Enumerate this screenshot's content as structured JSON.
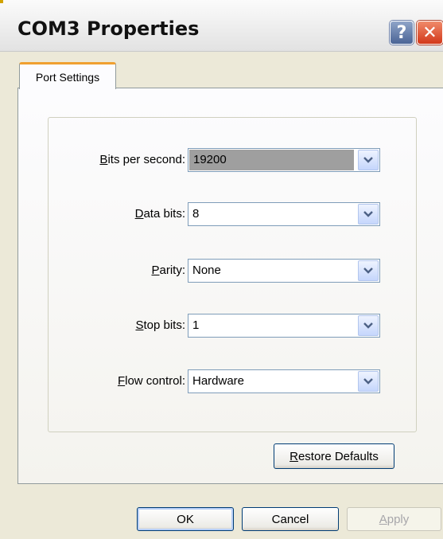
{
  "window": {
    "title": "COM3 Properties",
    "help_label": "?",
    "close_label": "✕"
  },
  "tabs": [
    {
      "label": "Port Settings",
      "active": true
    }
  ],
  "fields": {
    "bits_per_second": {
      "label_key": "B",
      "label_rest": "its per second:",
      "value": "19200",
      "selected": true
    },
    "data_bits": {
      "label_key": "D",
      "label_rest": "ata bits:",
      "value": "8"
    },
    "parity": {
      "label_key": "P",
      "label_rest": "arity:",
      "value": "None"
    },
    "stop_bits": {
      "label_key": "S",
      "label_rest": "top bits:",
      "value": "1"
    },
    "flow_control": {
      "label_key": "F",
      "label_rest": "low control:",
      "value": "Hardware"
    }
  },
  "buttons": {
    "restore_key": "R",
    "restore_rest": "estore Defaults",
    "ok": "OK",
    "cancel": "Cancel",
    "apply_key": "A",
    "apply_rest": "pply"
  },
  "colors": {
    "tab_accent": "#f0a030",
    "selected_highlight": "#9f9f9f",
    "close_button": "#d2381a",
    "help_button": "#4a6496"
  },
  "icons": {
    "dropdown": "chevron-down-icon",
    "help": "help-icon",
    "close": "close-icon"
  }
}
